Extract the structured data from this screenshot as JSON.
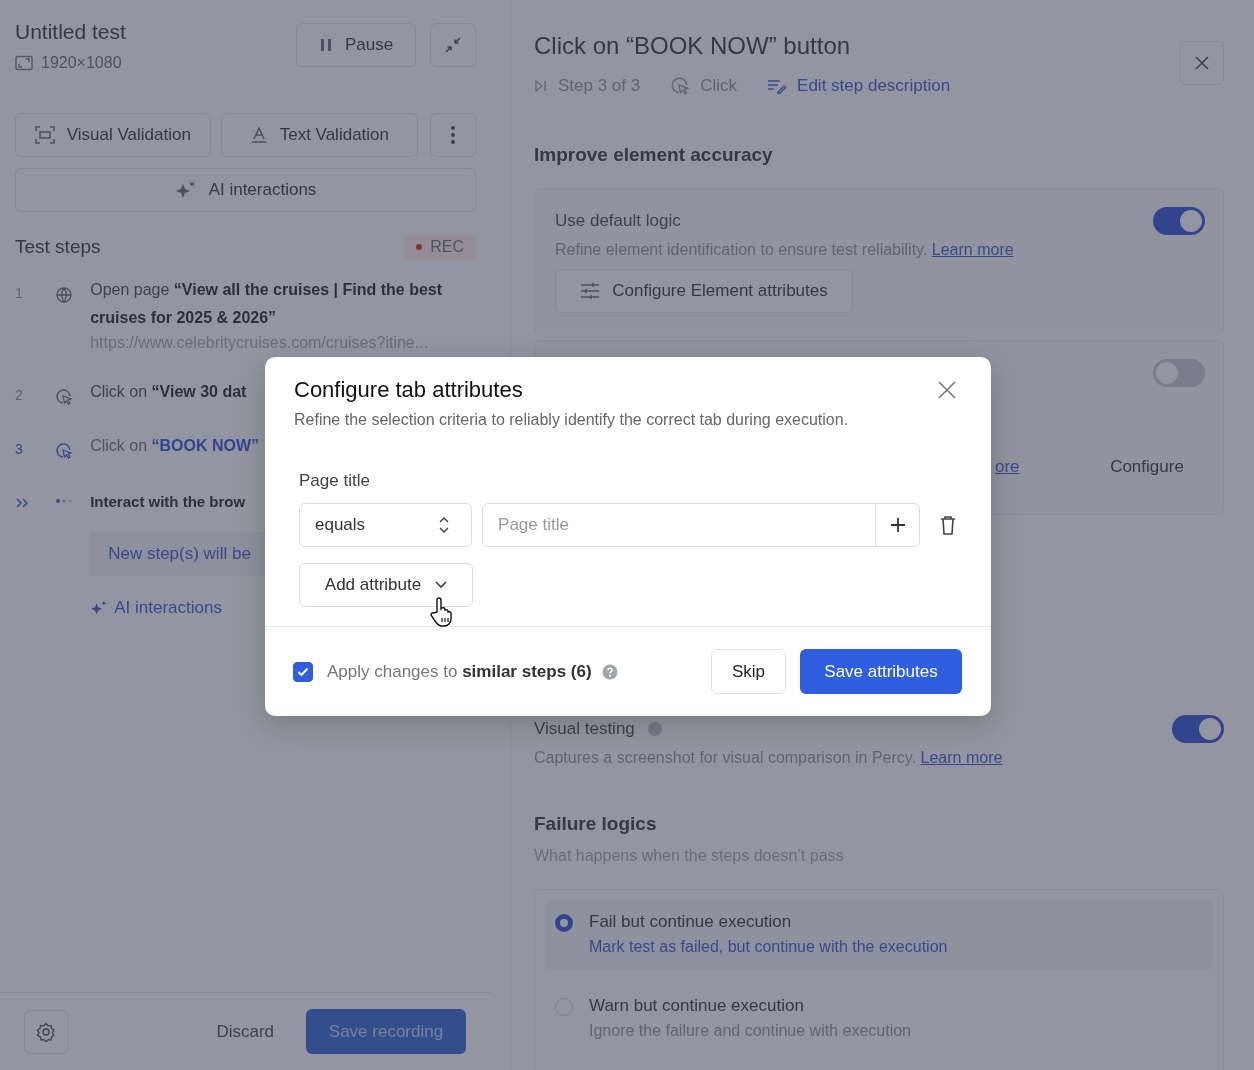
{
  "test": {
    "title": "Untitled test",
    "resolution": "1920×1080"
  },
  "header_buttons": {
    "pause": "Pause"
  },
  "validation_buttons": [
    "Visual Validation",
    "Text Validation"
  ],
  "ai_button": "AI interactions",
  "test_steps": {
    "title": "Test steps",
    "badge": "REC",
    "steps": [
      {
        "kind": "open",
        "number": "1",
        "text": "Open page **“View all the cruises | Find the best cruises for 2025 & 2026”**",
        "url": "https://www.celebritycruises.com/cruises?itine...",
        "selected": false
      },
      {
        "kind": "click",
        "number": "2",
        "text": "Click on **“View 30 dat**",
        "selected": false
      },
      {
        "kind": "click",
        "number": "3",
        "text": "Click on **“BOOK NOW”**",
        "selected": true
      },
      {
        "kind": "interact",
        "text": "Interact with the brow",
        "placeholder": "New step(s) will be",
        "link": "AI interactions",
        "selected": false
      }
    ]
  },
  "footer": {
    "discard": "Discard",
    "save": "Save recording"
  },
  "step_detail": {
    "title": "Click on “BOOK NOW” button",
    "step": "Step 3 of 3",
    "action": "Click",
    "edit_link": "Edit step description",
    "accuracy": {
      "title": "Improve element accuracy",
      "default_logic": {
        "label": "Use default logic",
        "on": true,
        "description": "Refine element identification to ensure test reliability.",
        "link": "Learn more",
        "button": "Configure Element attributes"
      },
      "second": {
        "on": false,
        "link": "ore",
        "button": "Configure"
      }
    },
    "visual_testing": {
      "label": "Visual testing",
      "on": true,
      "description": "Captures a screenshot for visual comparison in Percy.",
      "link": "Learn more"
    },
    "failure": {
      "title": "Failure logics",
      "subtitle": "What happens when the steps doesn’t pass",
      "options": [
        {
          "label": "Fail but continue execution",
          "description": "Mark test as failed, but continue with the execution",
          "selected": true
        },
        {
          "label": "Warn but continue execution",
          "description": "Ignore the failure and continue with execution",
          "selected": false
        }
      ]
    }
  },
  "modal": {
    "title": "Configure tab attributes",
    "subtitle": "Refine the selection criteria to reliably identify the correct tab during execution.",
    "field_label": "Page title",
    "operator": "equals",
    "placeholder": "Page title",
    "add_button": "Add attribute",
    "apply": {
      "checked": true,
      "text": "Apply changes to **similar steps (6)**"
    },
    "skip": "Skip",
    "save": "Save attributes"
  }
}
